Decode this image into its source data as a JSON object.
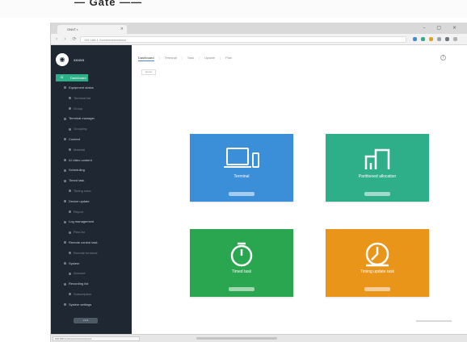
{
  "caption": "— Gate ——",
  "browser": {
    "tab_title": "ONVT ▪",
    "tab_close": "×",
    "window_controls": "– ▢ ×",
    "nav_buttons": "‹ › ⟳",
    "url": "192.168.1.1/xxxxxxxxxxxxxxx",
    "extension_colors": [
      "#3b8fd9",
      "#2fae8a",
      "#e0a21f",
      "#9aa3ad",
      "#6c757d",
      "#b0b0b0"
    ],
    "status_url": "192.168.1.1/xxxxxx/xxxxxxx/xxxxx"
  },
  "sidebar": {
    "logo_glyph": "◉",
    "brand": "XXXXX",
    "active_item": {
      "label": "Dashboard",
      "icon": "home-icon"
    },
    "items": [
      {
        "label": "Equipment status",
        "dim": false
      },
      {
        "label": "Terminal list",
        "dim": true
      },
      {
        "label": "Group",
        "dim": true
      },
      {
        "label": "Terminal manager",
        "dim": false
      },
      {
        "label": "Grouping",
        "dim": true
      },
      {
        "label": "Content",
        "dim": false
      },
      {
        "label": "Material",
        "dim": true
      },
      {
        "label": "AI video content",
        "dim": false
      },
      {
        "label": "Scheduling",
        "dim": false
      },
      {
        "label": "Timed task",
        "dim": false
      },
      {
        "label": "Timing rules",
        "dim": true
      },
      {
        "label": "Device update",
        "dim": false
      },
      {
        "label": "Report",
        "dim": true
      },
      {
        "label": "Log management",
        "dim": false
      },
      {
        "label": "Plan list",
        "dim": true
      },
      {
        "label": "Remote control task",
        "dim": false
      },
      {
        "label": "Remote terminal",
        "dim": true
      },
      {
        "label": "System",
        "dim": false
      },
      {
        "label": "Account",
        "dim": true
      },
      {
        "label": "Recording list",
        "dim": false
      },
      {
        "label": "Subscription",
        "dim": true
      },
      {
        "label": "System settings",
        "dim": false
      }
    ],
    "footer_pill": "v.1.0"
  },
  "main": {
    "breadcrumb": [
      "Dashboard",
      "Terminal",
      "Task",
      "Update",
      "Plan"
    ],
    "help_icon": "?",
    "home_chip": "Home",
    "tiles": [
      {
        "label": "Terminal",
        "color": "#3b8fd9",
        "icon": "terminal-icon"
      },
      {
        "label": "Partitioned allocation",
        "color": "#2fae8a",
        "icon": "partition-icon"
      },
      {
        "label": "Timed task",
        "color": "#2aa651",
        "icon": "timer-icon"
      },
      {
        "label": "Timing update task",
        "color": "#e8951a",
        "icon": "clock-icon"
      }
    ]
  }
}
